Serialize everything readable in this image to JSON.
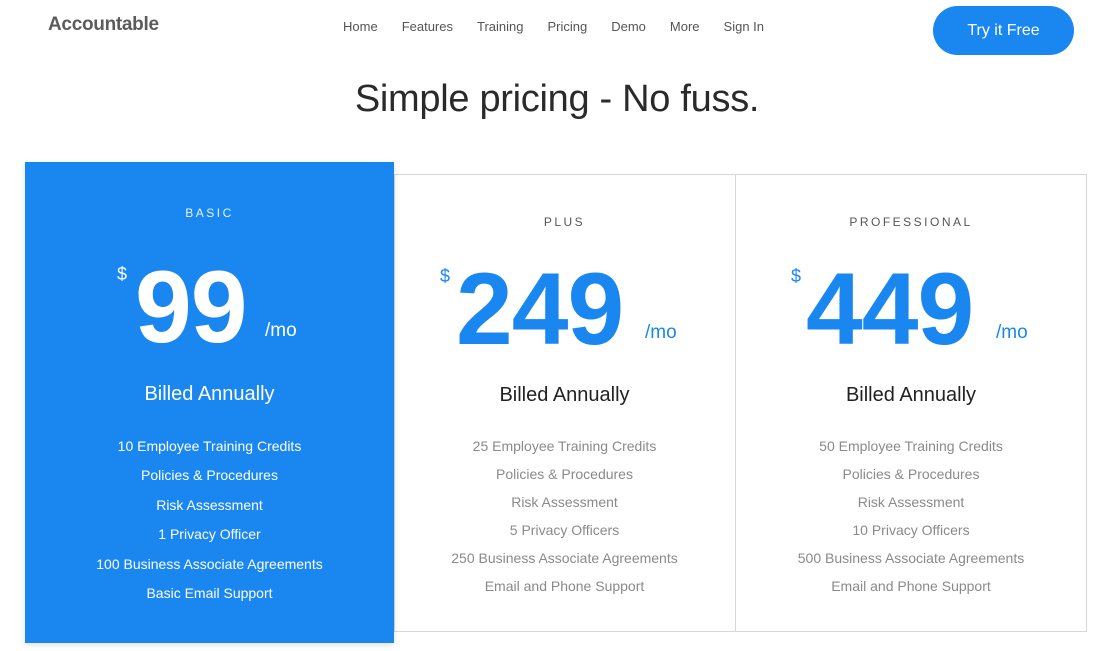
{
  "header": {
    "logo": "Accountable",
    "nav": [
      "Home",
      "Features",
      "Training",
      "Pricing",
      "Demo",
      "More",
      "Sign In"
    ],
    "cta": "Try it Free"
  },
  "hero": {
    "title": "Simple pricing - No fuss."
  },
  "plans": [
    {
      "name": "BASIC",
      "currency": "$",
      "price": "99",
      "per": "/mo",
      "billing": "Billed Annually",
      "features": [
        "10 Employee Training Credits",
        "Policies & Procedures",
        "Risk Assessment",
        "1 Privacy Officer",
        "100 Business Associate Agreements",
        "Basic Email Support"
      ]
    },
    {
      "name": "PLUS",
      "currency": "$",
      "price": "249",
      "per": "/mo",
      "billing": "Billed Annually",
      "features": [
        "25 Employee Training Credits",
        "Policies & Procedures",
        "Risk Assessment",
        "5 Privacy Officers",
        "250 Business Associate Agreements",
        "Email and Phone Support"
      ]
    },
    {
      "name": "PROFESSIONAL",
      "currency": "$",
      "price": "449",
      "per": "/mo",
      "billing": "Billed Annually",
      "features": [
        "50 Employee Training Credits",
        "Policies & Procedures",
        "Risk Assessment",
        "10 Privacy Officers",
        "500 Business Associate Agreements",
        "Email and Phone Support"
      ]
    }
  ],
  "colors": {
    "accent": "#1a87f0"
  }
}
